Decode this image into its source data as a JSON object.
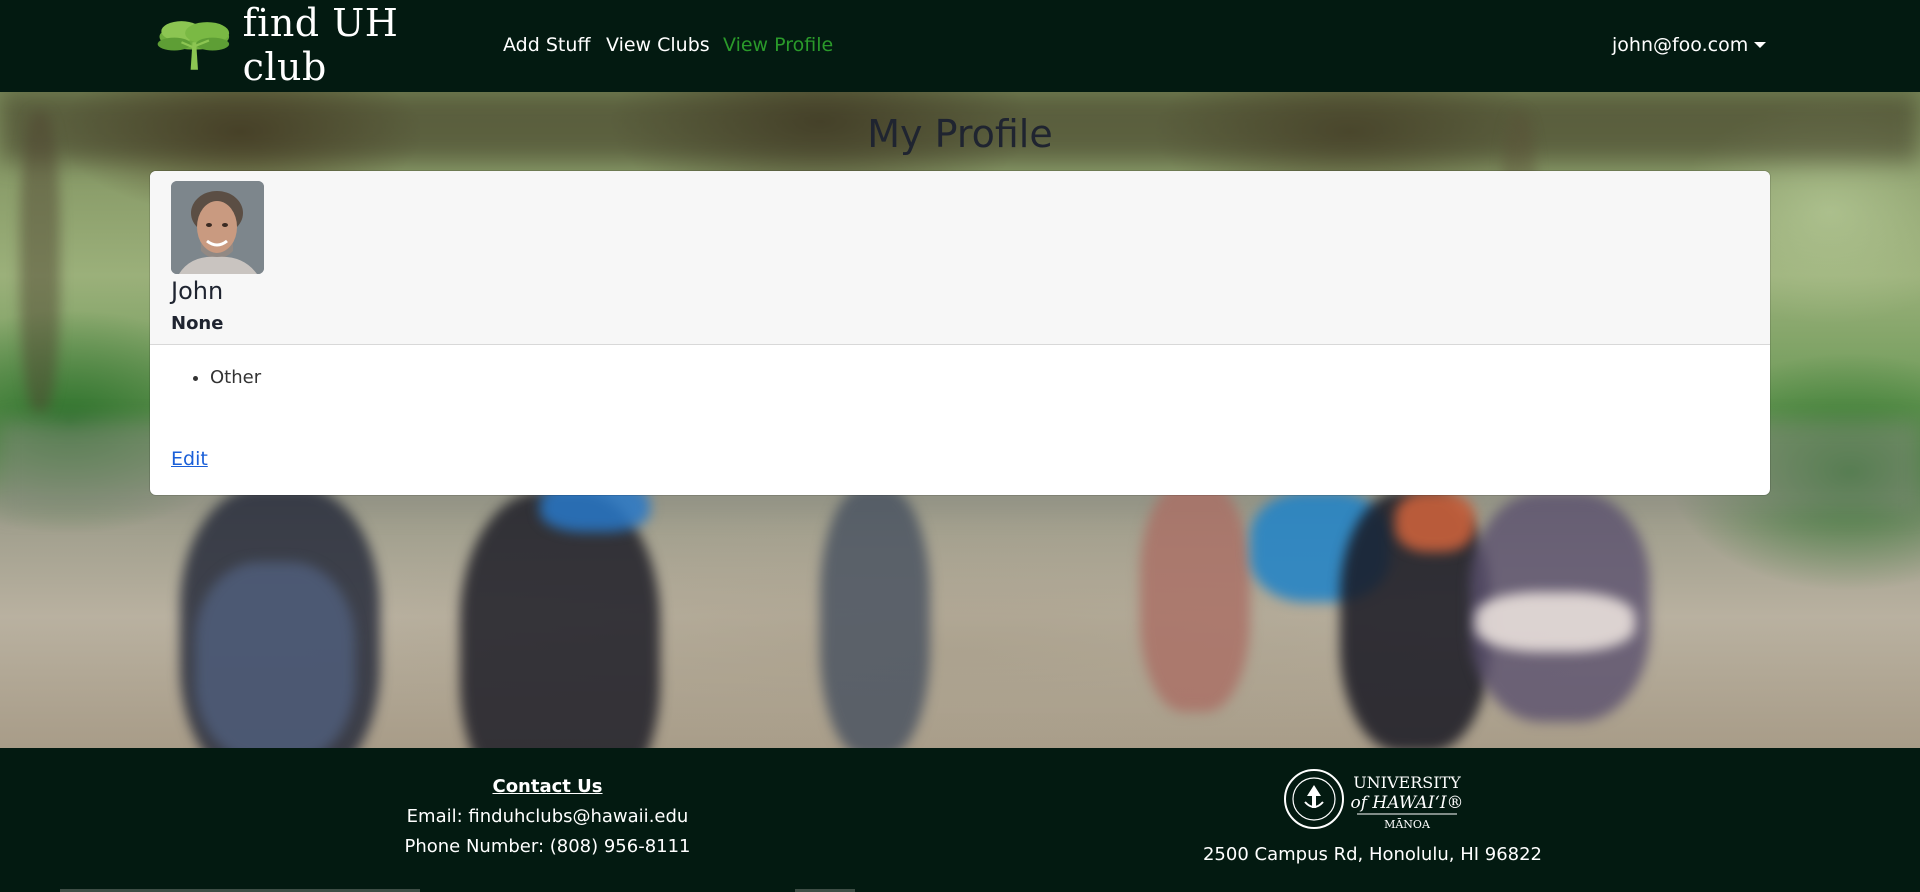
{
  "navbar": {
    "brand": "find UH club",
    "links": [
      {
        "label": "Add Stuff",
        "active": false
      },
      {
        "label": "View Clubs",
        "active": false
      },
      {
        "label": "View Profile",
        "active": true
      }
    ],
    "user": "john@foo.com",
    "icons": {
      "brand": "tree-icon",
      "user_menu": "caret-down-icon"
    }
  },
  "page": {
    "title": "My Profile"
  },
  "profile": {
    "name": "John",
    "subtitle": "None",
    "interests": [
      "Other"
    ],
    "edit_label": "Edit",
    "avatar": "profile-photo"
  },
  "footer": {
    "contact_title": "Contact Us",
    "email": "Email: finduhclubs@hawaii.edu",
    "phone": "Phone Number: (808) 956-8111",
    "university_logo": {
      "line1": "UNIVERSITY",
      "line2": "of HAWAIʻI®",
      "line3": "MĀNOA"
    },
    "address": "2500 Campus Rd, Honolulu, HI 96822"
  },
  "colors": {
    "nav_bg": "#031a11",
    "active_link": "#2a9a2a",
    "link": "#1a5fd8",
    "footer_bg": "#031a11"
  }
}
